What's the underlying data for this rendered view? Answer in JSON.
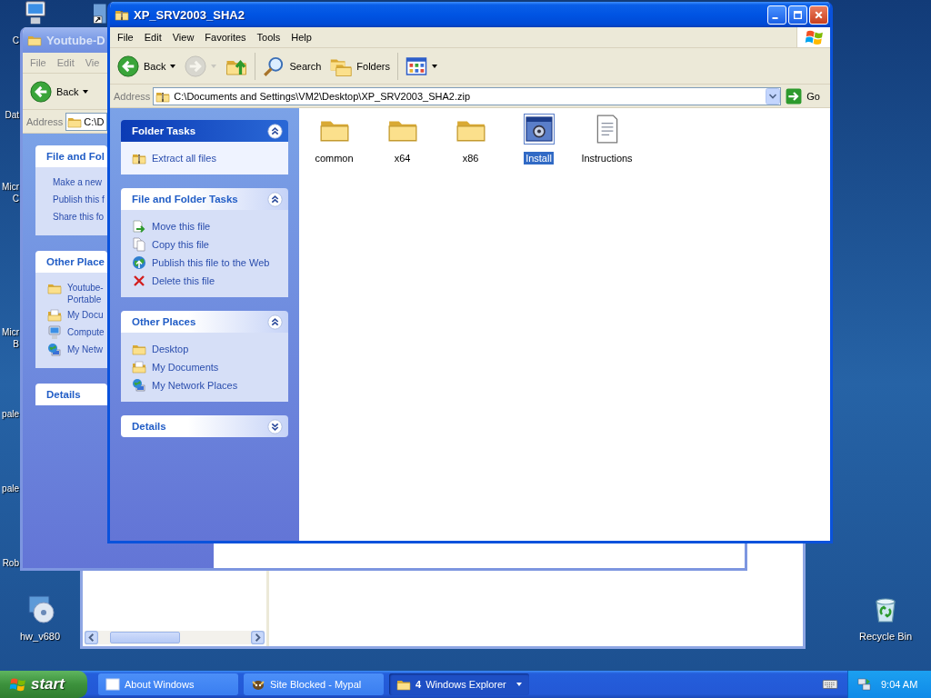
{
  "desktop_edge_labels": [
    {
      "lines": [
        "C"
      ]
    },
    {
      "lines": [
        "Dat"
      ]
    },
    {
      "lines": [
        "Micr",
        "C"
      ]
    },
    {
      "lines": [
        "Micr",
        "B"
      ]
    },
    {
      "lines": [
        "pale"
      ]
    },
    {
      "lines": [
        "pale"
      ]
    },
    {
      "lines": [
        "Rob"
      ]
    }
  ],
  "desktop_icons": [
    {
      "label": "hw_v680",
      "kind": "disc"
    },
    {
      "label": "Recycle Bin",
      "kind": "recycle"
    }
  ],
  "back_window": {
    "kind": "explorer"
  },
  "youtube_window": {
    "title": "Youtube-D",
    "menu": [
      "File",
      "Edit",
      "Vie"
    ],
    "back": "Back",
    "address_label": "Address",
    "address": "C:\\D",
    "task_sections": [
      {
        "title": "File and Fol",
        "expanded": true,
        "items": [
          {
            "lines": [
              "Make a new"
            ]
          },
          {
            "lines": [
              "Publish this f"
            ]
          },
          {
            "lines": [
              "Share this fo"
            ]
          }
        ]
      },
      {
        "title": "Other Place",
        "expanded": true,
        "items": [
          {
            "lines": [
              "Youtube-",
              "Portable"
            ],
            "kind": "folder"
          },
          {
            "lines": [
              "My Docu"
            ],
            "kind": "documents"
          },
          {
            "lines": [
              "Compute"
            ],
            "kind": "computer"
          },
          {
            "lines": [
              "My Netw"
            ],
            "kind": "network"
          }
        ]
      },
      {
        "title": "Details",
        "expanded": false
      }
    ]
  },
  "explorer_window": {
    "title": "XP_SRV2003_SHA2",
    "menu": [
      "File",
      "Edit",
      "View",
      "Favorites",
      "Tools",
      "Help"
    ],
    "toolbar": [
      {
        "kind": "back",
        "label": "Back",
        "disabled": false
      },
      {
        "kind": "forward",
        "disabled": true
      },
      {
        "kind": "up",
        "disabled": false
      },
      {
        "kind": "search",
        "label": "Search",
        "disabled": false
      },
      {
        "kind": "folders",
        "label": "Folders",
        "disabled": false
      },
      {
        "kind": "views",
        "disabled": false
      }
    ],
    "address_label": "Address",
    "address": "C:\\Documents and Settings\\VM2\\Desktop\\XP_SRV2003_SHA2.zip",
    "go": "Go",
    "task_sections": [
      {
        "title": "Folder Tasks",
        "special": true,
        "expanded": true,
        "items": [
          {
            "label": "Extract all files",
            "kind": "zip"
          }
        ]
      },
      {
        "title": "File and Folder Tasks",
        "special": false,
        "expanded": true,
        "items": [
          {
            "label": "Move this file",
            "kind": "move"
          },
          {
            "label": "Copy this file",
            "kind": "copy"
          },
          {
            "label": "Publish this file to the Web",
            "kind": "publish"
          },
          {
            "label": "Delete this file",
            "kind": "delete"
          }
        ]
      },
      {
        "title": "Other Places",
        "special": false,
        "expanded": true,
        "items": [
          {
            "label": "Desktop",
            "kind": "folder"
          },
          {
            "label": "My Documents",
            "kind": "documents"
          },
          {
            "label": "My Network Places",
            "kind": "network"
          }
        ]
      },
      {
        "title": "Details",
        "special": false,
        "expanded": false
      }
    ],
    "files": [
      {
        "name": "common",
        "kind": "folder",
        "selected": false
      },
      {
        "name": "x64",
        "kind": "folder",
        "selected": false
      },
      {
        "name": "x86",
        "kind": "folder",
        "selected": false
      },
      {
        "name": "Install",
        "kind": "app",
        "selected": true
      },
      {
        "name": "Instructions",
        "kind": "doc",
        "selected": false
      }
    ]
  },
  "taskbar": {
    "start": "start",
    "buttons": [
      {
        "label": "About Windows",
        "kind": "window",
        "selected": false,
        "grouped": false
      },
      {
        "label": "Site Blocked - Mypal",
        "kind": "browser",
        "selected": false,
        "grouped": false
      },
      {
        "count": "4",
        "label": "Windows Explorer",
        "kind": "folder",
        "selected": true,
        "grouped": true
      }
    ],
    "clock": "9:04 AM"
  }
}
